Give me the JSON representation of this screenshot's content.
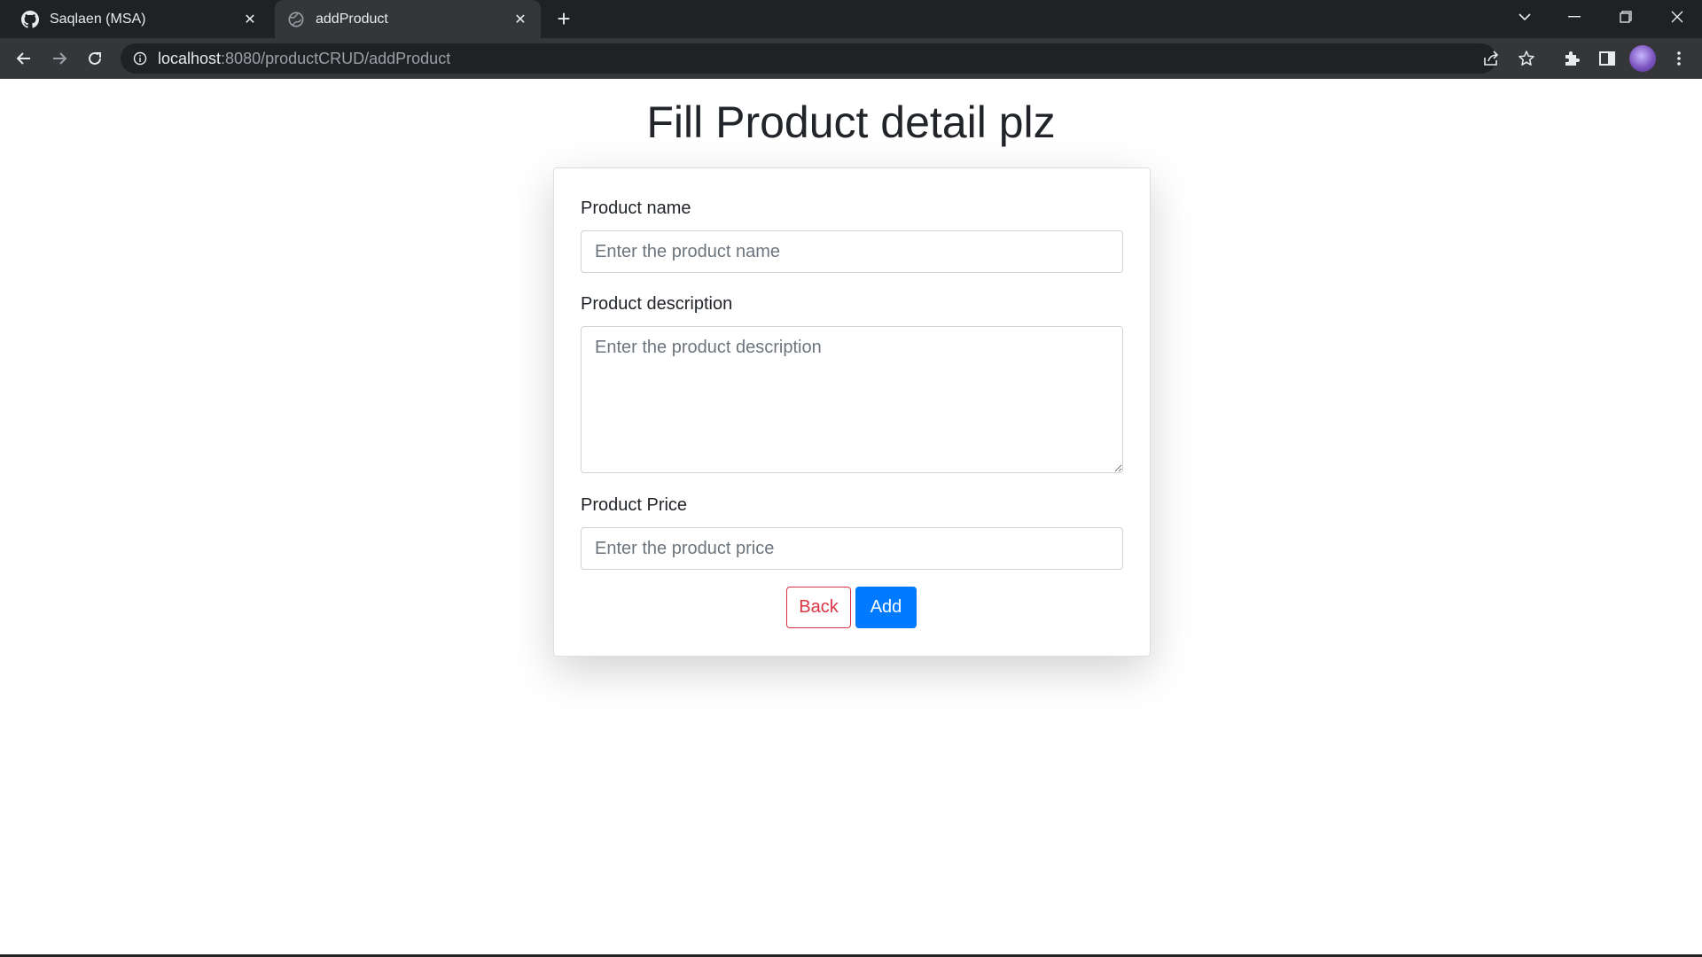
{
  "browser": {
    "tabs": [
      {
        "title": "Saqlaen (MSA)",
        "icon": "github-icon",
        "active": false
      },
      {
        "title": "addProduct",
        "icon": "globe-icon",
        "active": true
      }
    ],
    "url_host": "localhost",
    "url_rest": ":8080/productCRUD/addProduct",
    "new_tab_label": "+"
  },
  "page": {
    "heading": "Fill Product detail plz",
    "form": {
      "name_label": "Product name",
      "name_placeholder": "Enter the product name",
      "description_label": "Product description",
      "description_placeholder": "Enter the product description",
      "price_label": "Product Price",
      "price_placeholder": "Enter the product price",
      "back_label": "Back",
      "add_label": "Add"
    }
  },
  "colors": {
    "back_button": "#dc3545",
    "add_button": "#007bff",
    "chrome_dark": "#202124",
    "chrome_toolbar": "#35363a"
  }
}
